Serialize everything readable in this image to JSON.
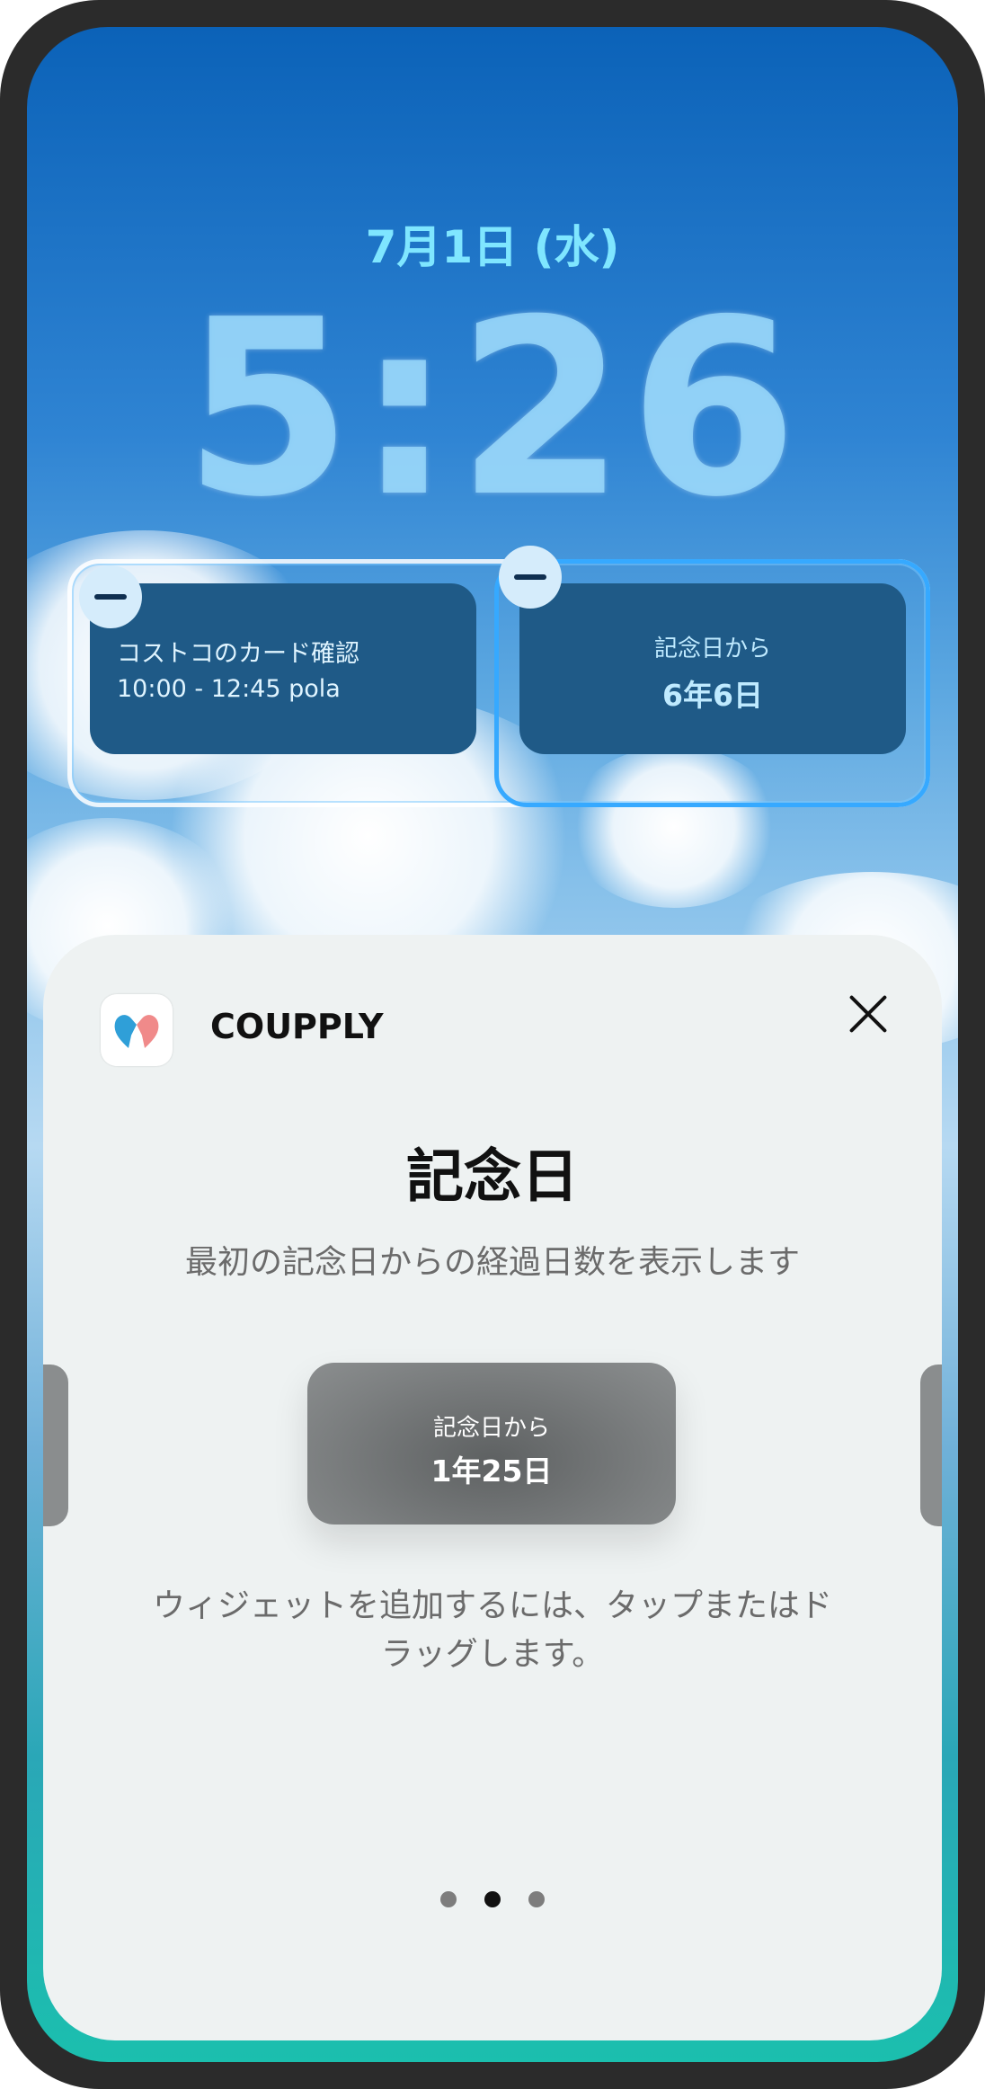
{
  "lockscreen": {
    "date": "7月1日 (水)",
    "time": "5:26",
    "widgets": [
      {
        "line1": "コストコのカード確認",
        "line2": "10:00 - 12:45 pola"
      },
      {
        "line1": "記念日から",
        "line2": "6年6日"
      }
    ]
  },
  "sheet": {
    "app_name": "COUPPLY",
    "title": "記念日",
    "description": "最初の記念日からの経過日数を表示します",
    "preview": {
      "line1": "記念日から",
      "line2": "1年25日"
    },
    "hint": "ウィジェットを追加するには、タップまたはドラッグします。",
    "page_indicator": {
      "pages": 3,
      "current": 2
    }
  },
  "colors": {
    "accent_cyan": "#7fe6ff",
    "widget_bg": "#1f5a87",
    "selection_border": "#36a9ff",
    "sheet_bg": "#eef2f2"
  },
  "icons": [
    "minus-icon",
    "close-icon",
    "couple-heart-app-icon"
  ]
}
